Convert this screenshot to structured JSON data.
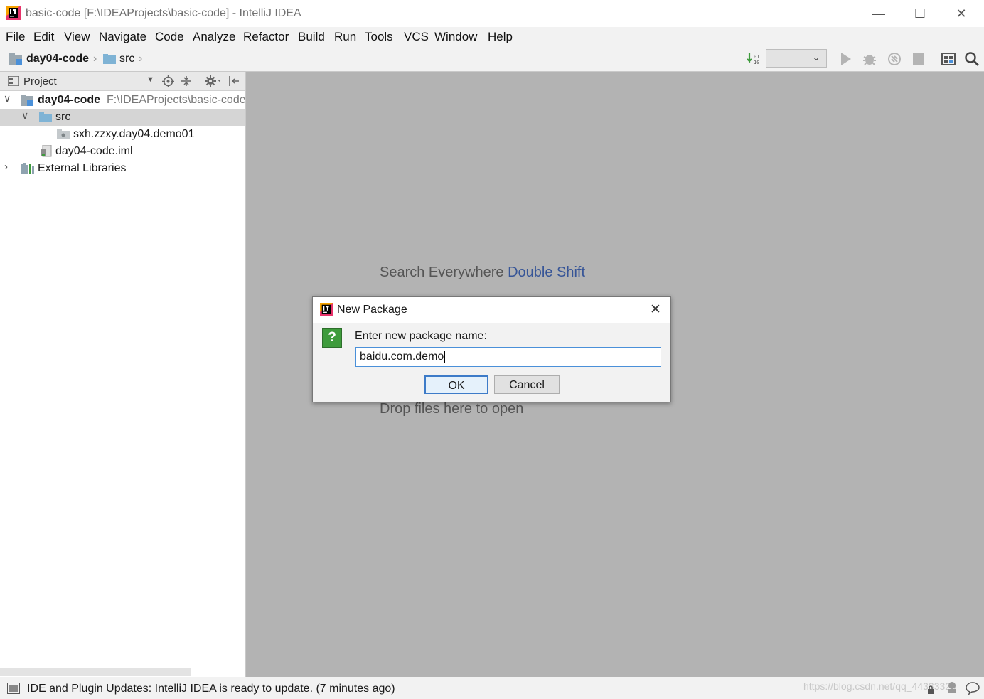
{
  "window": {
    "title": "basic-code [F:\\IDEAProjects\\basic-code] - IntelliJ IDEA",
    "controls": {
      "minimize": "—",
      "maximize": "☐",
      "close": "✕"
    }
  },
  "menu": [
    "File",
    "Edit",
    "View",
    "Navigate",
    "Code",
    "Analyze",
    "Refactor",
    "Build",
    "Run",
    "Tools",
    "VCS",
    "Window",
    "Help"
  ],
  "navbar": {
    "breadcrumbs": [
      "day04-code",
      "src"
    ]
  },
  "project_panel": {
    "header_label": "Project",
    "tree": [
      {
        "label": "day04-code",
        "path": "F:\\IDEAProjects\\basic-code"
      },
      {
        "label": "src"
      },
      {
        "label": "sxh.zzxy.day04.demo01"
      },
      {
        "label": "day04-code.iml"
      },
      {
        "label": "External Libraries"
      }
    ]
  },
  "editor": {
    "search_hint": "Search Everywhere",
    "search_key": "Double Shift",
    "drop_hint": "Drop files here to open"
  },
  "dialog": {
    "title": "New Package",
    "question_mark": "?",
    "prompt": "Enter new package name:",
    "input_value": "baidu.com.demo",
    "ok_label": "OK",
    "cancel_label": "Cancel"
  },
  "statusbar": {
    "message": "IDE and Plugin Updates: IntelliJ IDEA is ready to update. (7 minutes ago)",
    "watermark": "https://blog.csdn.net/qq_44333320"
  },
  "colors": {
    "editor_bg": "#b3b3b3",
    "folder_blue": "#7fb3d5",
    "key_blue": "#375597",
    "accent_green": "#3e9b3c"
  }
}
